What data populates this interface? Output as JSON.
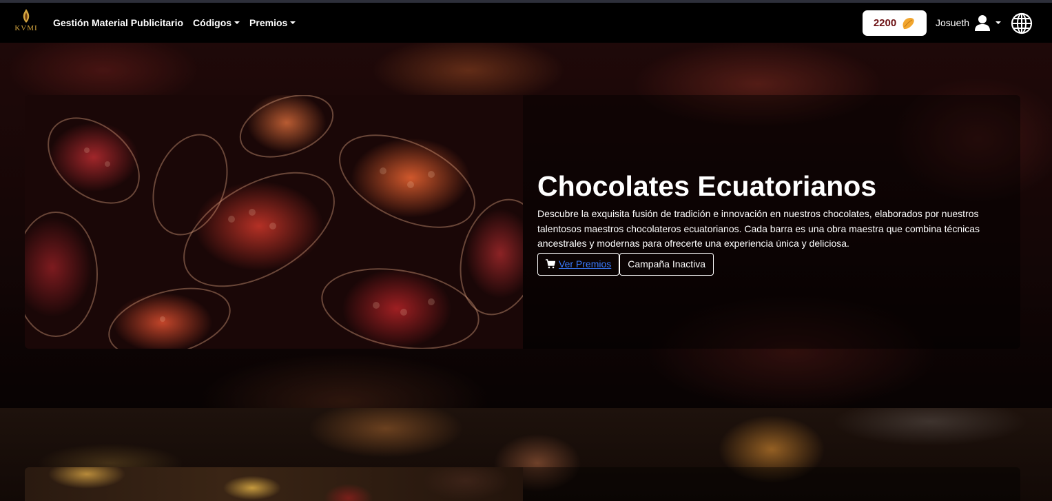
{
  "navbar": {
    "brand_text": "KVMI",
    "links": [
      {
        "label": "Gestión Material Publicitario",
        "dropdown": false
      },
      {
        "label": "Códigos",
        "dropdown": true
      },
      {
        "label": "Premios",
        "dropdown": true
      }
    ],
    "points": "2200",
    "points_icon": "cocoa-bean-icon",
    "user_name": "Josueth",
    "user_icon": "user-icon",
    "language_icon": "globe-icon"
  },
  "hero": {
    "title": "Chocolates Ecuatorianos",
    "description": "Descubre la exquisita fusión de tradición e innovación en nuestros chocolates, elaborados por nuestros talentosos maestros chocolateros ecuatorianos. Cada barra es una obra maestra que combina técnicas ancestrales y modernas para ofrecerte una experiencia única y deliciosa.",
    "btn_premios": "Ver Premios",
    "btn_premios_icon": "cart-icon",
    "btn_status": "Campaña Inactiva"
  },
  "colors": {
    "navbar_bg": "#000000",
    "points_text": "#6b0f12",
    "accent_gold": "#d4a640",
    "link_blue": "#3a7bff"
  }
}
